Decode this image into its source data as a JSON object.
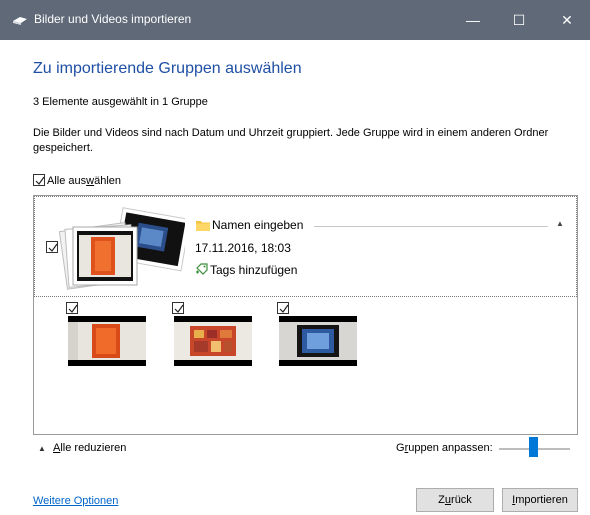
{
  "window": {
    "title": "Bilder und Videos importieren",
    "minimize_label": "—",
    "maximize_label": "☐",
    "close_label": "✕"
  },
  "heading": "Zu importierende Gruppen auswählen",
  "selection_summary": "3 Elemente ausgewählt in 1 Gruppe",
  "description": "Die Bilder und Videos sind nach Datum und Uhrzeit gruppiert. Jede Gruppe wird in einem anderen Ordner gespeichert.",
  "select_all": {
    "label_pre": "Alle aus",
    "label_accel": "w",
    "label_post": "ählen",
    "checked": true
  },
  "group": {
    "checked": true,
    "name_placeholder": "Namen eingeben",
    "date": "17.11.2016, 18:03",
    "tags_label": "Tags hinzufügen",
    "collapse_caret": "▲",
    "items": [
      {
        "checked": true,
        "icon": "orange-art-thumbnail"
      },
      {
        "checked": true,
        "icon": "patterned-art-thumbnail"
      },
      {
        "checked": true,
        "icon": "blue-screen-thumbnail"
      }
    ]
  },
  "footer": {
    "collapse_caret": "▲",
    "collapse_all_accel": "A",
    "collapse_all_rest": "lle reduzieren",
    "adjust_pre": "G",
    "adjust_accel": "r",
    "adjust_post": "uppen anpassen:",
    "more_options": "Weitere Optionen",
    "back_pre": "Z",
    "back_accel": "u",
    "back_post": "rück",
    "import_pre": "",
    "import_accel": "I",
    "import_post": "mportieren"
  },
  "colors": {
    "titlebar": "#5f6977",
    "heading": "#1f4fa5",
    "link": "#0066cc",
    "slider": "#0078d7"
  }
}
